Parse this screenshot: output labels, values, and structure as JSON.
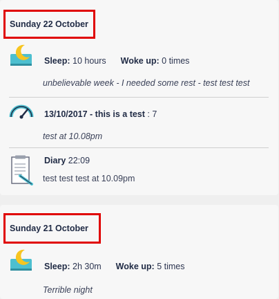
{
  "days": [
    {
      "date": "Sunday 22 October",
      "entries": [
        {
          "type": "sleep",
          "icon": "moon-pillow-icon",
          "sleep_label": "Sleep:",
          "sleep_value": "10 hours",
          "wake_label": "Woke up:",
          "wake_value": "0 times",
          "note": "unbelievable week - I needed some rest - test test test"
        },
        {
          "type": "measure",
          "icon": "gauge-icon",
          "title": "13/10/2017 - this is a test",
          "separator": ":",
          "value": "7",
          "note": "test at 10.08pm"
        },
        {
          "type": "diary",
          "icon": "notepad-pen-icon",
          "title": "Diary",
          "time": "22:09",
          "note": "test test test at 10.09pm"
        }
      ]
    },
    {
      "date": "Sunday 21 October",
      "entries": [
        {
          "type": "sleep",
          "icon": "moon-pillow-icon",
          "sleep_label": "Sleep:",
          "sleep_value": "2h 30m",
          "wake_label": "Woke up:",
          "wake_value": "5 times",
          "note": "Terrible night"
        }
      ]
    }
  ],
  "colors": {
    "highlight_border": "#e00000",
    "icon_teal": "#4dbfcf",
    "icon_yellow": "#f7c520",
    "text_dark": "#1f2a44"
  }
}
